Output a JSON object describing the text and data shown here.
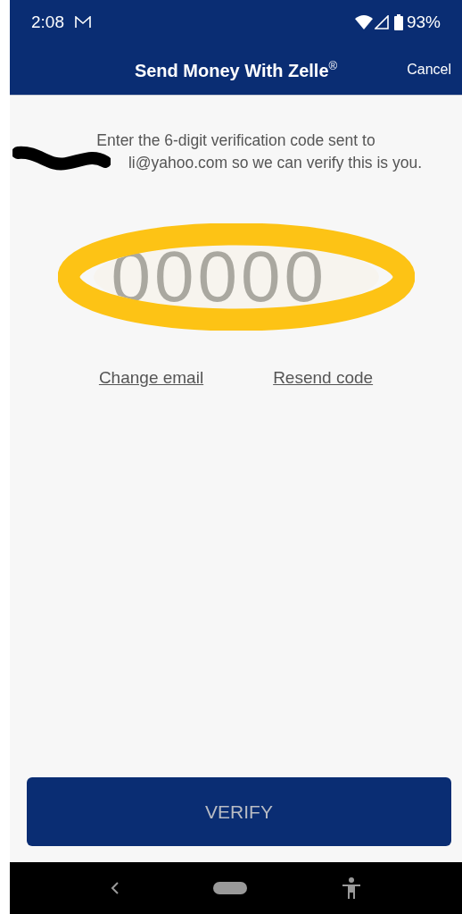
{
  "status_bar": {
    "time": "2:08",
    "battery": "93%"
  },
  "app_bar": {
    "title": "Send Money With Zelle$^{®}$",
    "action": "Cancel"
  },
  "message": {
    "line_1": "Enter the 6-digit verification code sent to",
    "line_2": "li@yahoo.com so we can verify this is you."
  },
  "code_field": {
    "placeholder": "00000"
  },
  "links": [
    "Change email",
    "Resend code"
  ],
  "verify_button": {
    "label": "VERIFY",
    "disabled": true
  }
}
